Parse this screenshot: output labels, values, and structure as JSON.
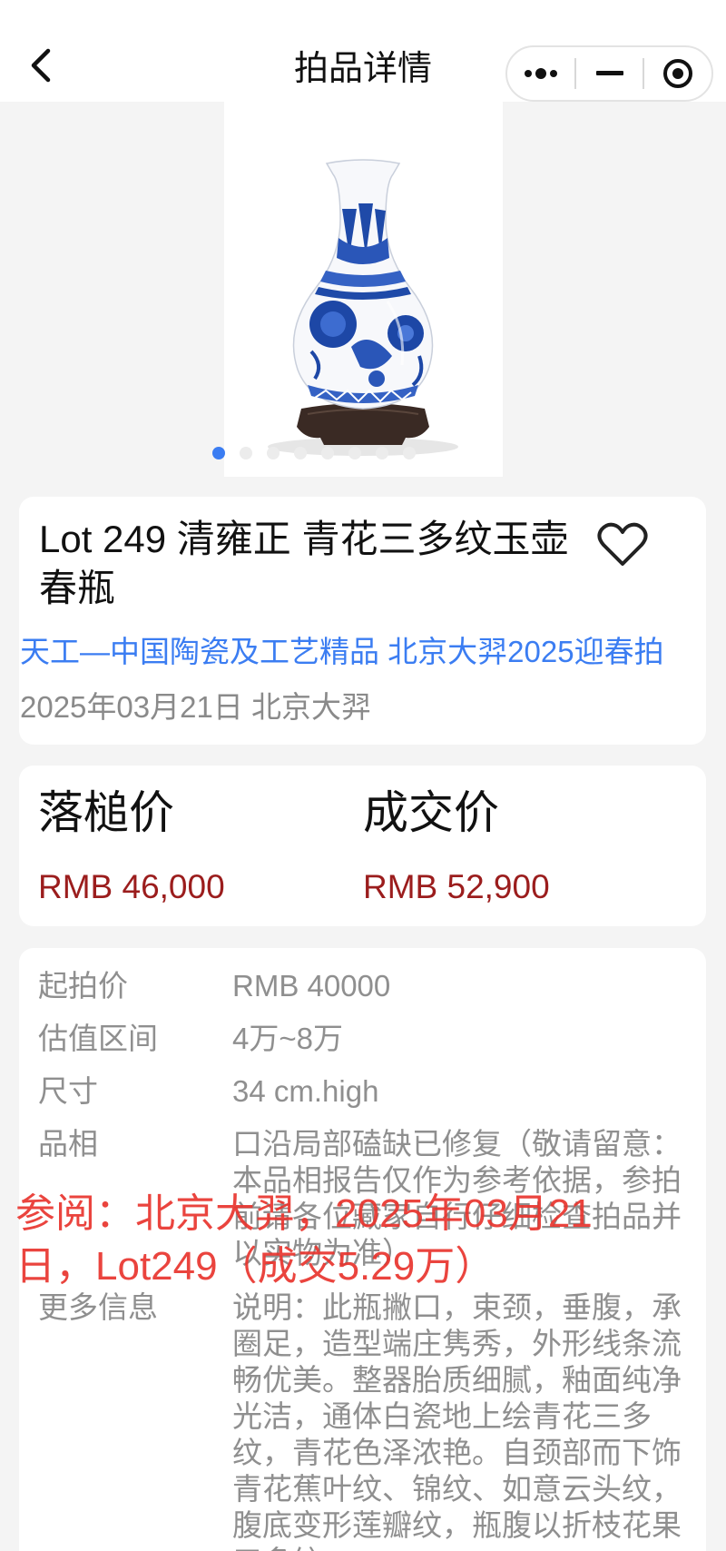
{
  "nav": {
    "title": "拍品详情",
    "back_icon": "chevron-left-icon",
    "more_icon": "more-dots-icon",
    "minimize_icon": "minimize-icon",
    "close_icon": "target-close-icon"
  },
  "gallery": {
    "image_subject": "blue-and-white vase on wooden stand",
    "dot_count": 8,
    "active_index": 0
  },
  "lot": {
    "title": "Lot 249 清雍正 青花三多纹玉壶春瓶",
    "favorite_icon": "heart-outline-icon",
    "sale_name": "天工—中国陶瓷及工艺精品 北京大羿2025迎春拍",
    "sale_date": "2025年03月21日 北京大羿"
  },
  "prices": {
    "hammer_label": "落槌价",
    "hammer_value": "RMB 46,000",
    "final_label": "成交价",
    "final_value": "RMB 52,900"
  },
  "details": {
    "rows": [
      {
        "label": "起拍价",
        "value": "RMB 40000"
      },
      {
        "label": "估值区间",
        "value": "4万~8万"
      },
      {
        "label": "尺寸",
        "value": "34 cm.high"
      },
      {
        "label": "品相",
        "value": "口沿局部磕缺已修复（敬请留意：本品相报告仅作为参考依据，参拍前请各位藏家自行仔细检查拍品并以实物为准）"
      },
      {
        "label": "更多信息",
        "value": "说明：此瓶撇口，束颈，垂腹，承圈足，造型端庄隽秀，外形线条流畅优美。整器胎质细腻，釉面纯净光洁，通体白瓷地上绘青花三多纹，青花色泽浓艳。自颈部而下饰青花蕉叶纹、锦纹、如意云头纹，腹底变形莲瓣纹，瓶腹以折枝花果三多纹"
      }
    ]
  },
  "watermark": {
    "text": "参阅：北京大羿，2025年03月21日，Lot249（成交5.29万）"
  },
  "colors": {
    "accent_blue": "#3b7df2",
    "price_red": "#9b1d1d",
    "watermark_red": "#e8342e",
    "muted_gray": "#8f8f8f"
  }
}
